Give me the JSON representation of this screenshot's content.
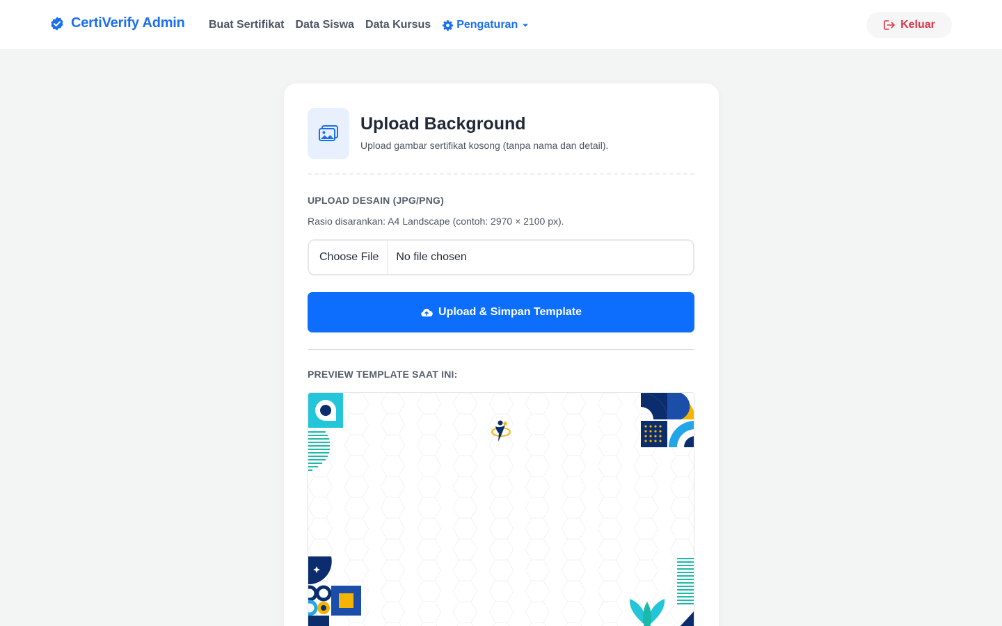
{
  "navbar": {
    "brand": "CertiVerify Admin",
    "links": [
      "Buat Sertifikat",
      "Data Siswa",
      "Data Kursus"
    ],
    "dropdown_label": "Pengaturan",
    "logout_label": "Keluar"
  },
  "card": {
    "title": "Upload Background",
    "subtitle": "Upload gambar sertifikat kosong (tanpa nama dan detail).",
    "upload_label": "UPLOAD DESAIN (JPG/PNG)",
    "hint": "Rasio disarankan: A4 Landscape (contoh: 2970 × 2100 px).",
    "file_button": "Choose File",
    "file_status": "No file chosen",
    "submit_label": "Upload & Simpan Template",
    "preview_label": "PREVIEW TEMPLATE SAAT INI:"
  },
  "colors": {
    "accent": "#0d6efd",
    "brand": "#1a6ff0",
    "danger": "#dc3545",
    "navy": "#0b2d6e",
    "teal": "#1bb9a9",
    "cyan": "#22c6d8",
    "yellow": "#f5b400"
  },
  "icons": {
    "brand": "verified-badge-icon",
    "dropdown": "gear-icon",
    "logout": "logout-icon",
    "header": "image-icon",
    "upload": "cloud-upload-icon"
  }
}
